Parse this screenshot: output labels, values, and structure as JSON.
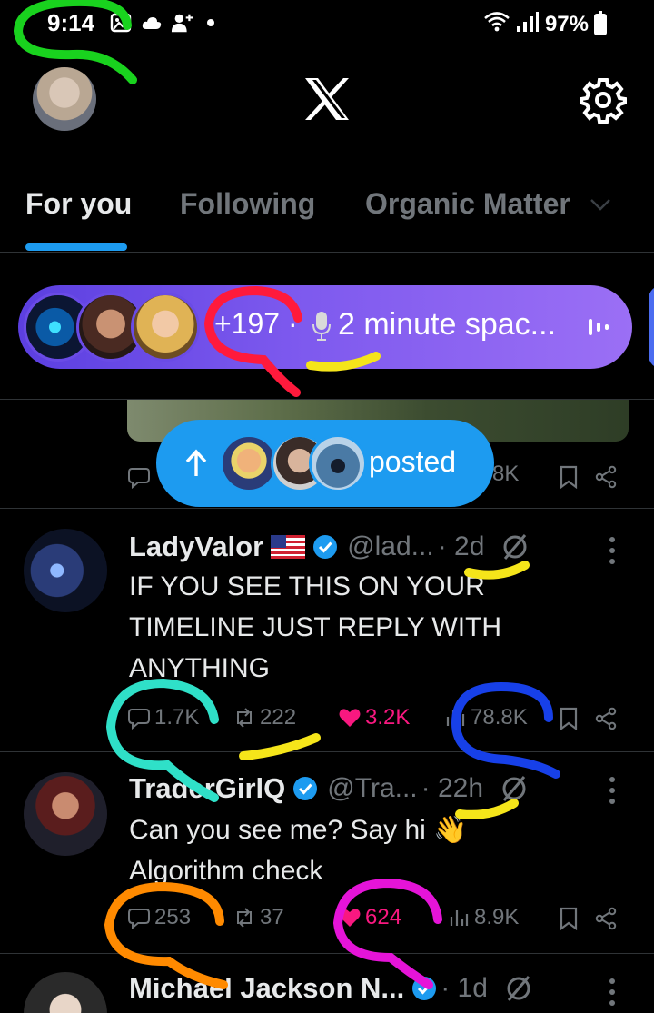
{
  "status_bar": {
    "time": "9:14",
    "battery": "97%"
  },
  "header": {
    "avatar": "profile-avatar",
    "logo": "x-logo",
    "settings": "gear-icon"
  },
  "tabs": [
    {
      "label": "For you",
      "active": true
    },
    {
      "label": "Following",
      "active": false
    },
    {
      "label": "Organic Matter",
      "active": false
    }
  ],
  "space": {
    "count": "+197 ·",
    "title": "2 minute spac..."
  },
  "previous_post": {
    "views": "8K"
  },
  "posted_banner": {
    "label": "posted"
  },
  "tweets": [
    {
      "name": "LadyValor",
      "handle": "@lad...",
      "time": "· 2d",
      "text_lines": [
        "IF YOU SEE THIS ON YOUR",
        "TIMELINE JUST REPLY WITH",
        "ANYTHING"
      ],
      "replies": "1.7K",
      "reposts": "222",
      "likes": "3.2K",
      "views": "78.8K"
    },
    {
      "name": "TraderGirlQ",
      "handle": "@Tra...",
      "time": "· 22h",
      "text_lines": [
        "Can you see me? Say hi 👋",
        "Algorithm check"
      ],
      "replies": "253",
      "reposts": "37",
      "likes": "624",
      "views": "8.9K"
    },
    {
      "name": "Michael Jackson N...",
      "handle": "",
      "time": "· 1d"
    }
  ],
  "colors": {
    "accent": "#1d9bf0",
    "like": "#f91880",
    "muted": "#71767b"
  }
}
